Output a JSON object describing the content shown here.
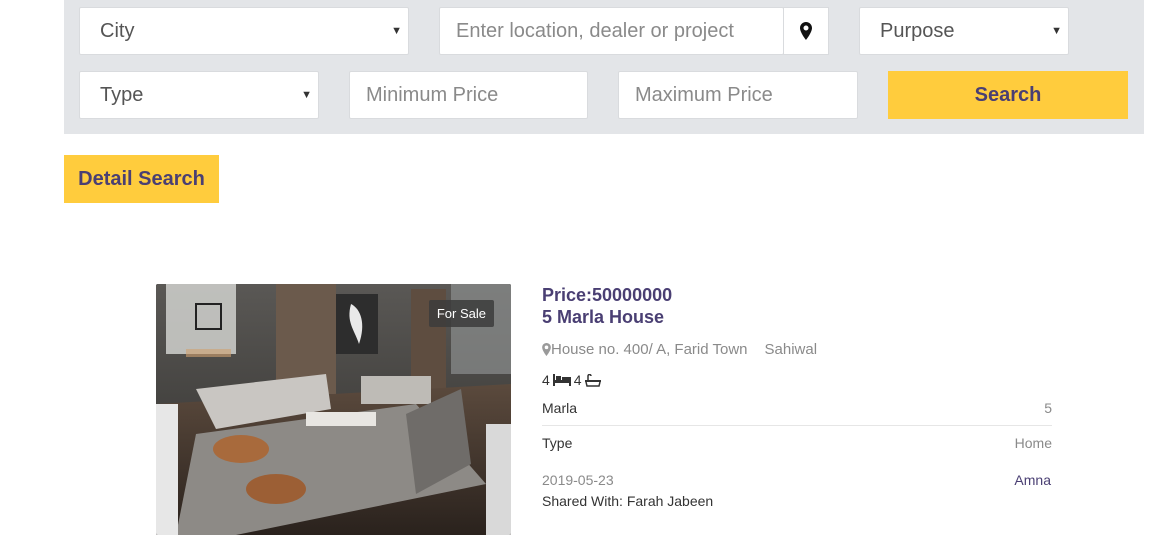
{
  "search": {
    "city": "City",
    "location_placeholder": "Enter location, dealer or project",
    "purpose": "Purpose",
    "type": "Type",
    "min_price_placeholder": "Minimum Price",
    "max_price_placeholder": "Maximum Price",
    "search_label": "Search",
    "location_icon": "map-pin-icon"
  },
  "detail_search_label": "Detail Search",
  "listing": {
    "badge": "For Sale",
    "price": "Price:50000000",
    "title": "5 Marla House",
    "address": "House no. 400/ A, Farid Town",
    "city": "Sahiwal",
    "beds": "4",
    "baths": "4",
    "area_label": "Marla",
    "area_value": "5",
    "type_label": "Type",
    "type_value": "Home",
    "date": "2019-05-23",
    "agent": "Amna",
    "shared_with": "Shared With: Farah Jabeen"
  },
  "colors": {
    "accent_yellow": "#ffcc3d",
    "brand_purple": "#4a3f73",
    "panel_bg": "#e3e5e8"
  }
}
